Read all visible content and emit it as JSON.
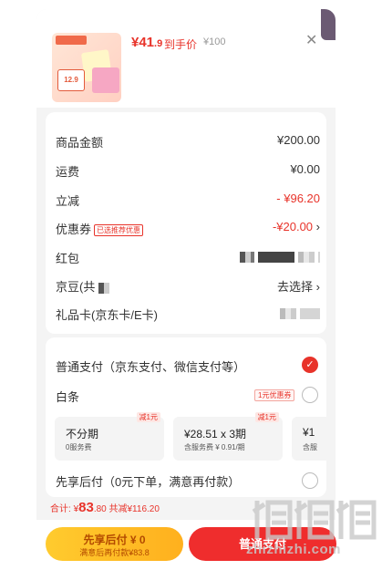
{
  "product": {
    "hand_price_main": "¥41",
    "hand_price_cents": ".9",
    "hand_price_label": "到手价",
    "original_price": "¥100",
    "thumbnail_sticker": "12.9"
  },
  "details": {
    "rows": [
      {
        "label": "商品金额",
        "value": "¥200.00"
      },
      {
        "label": "运费",
        "value": "¥0.00"
      },
      {
        "label": "立减",
        "value": "- ¥96.20"
      },
      {
        "label": "优惠券",
        "badge": "已选推荐优惠",
        "value": "-¥20.00",
        "chevron": "›"
      },
      {
        "label": "红包"
      },
      {
        "label": "京豆(共",
        "value": "去选择",
        "chevron": "›"
      },
      {
        "label": "礼品卡(京东卡/E卡)"
      }
    ]
  },
  "payment": {
    "normal_pay_label": "普通支付（京东支付、微信支付等）",
    "baitiao_label": "白条",
    "baitiao_coupon": "1元优惠券",
    "plans": [
      {
        "title": "不分期",
        "sub": "0服务费",
        "flag": "减1元"
      },
      {
        "title": "¥28.51 x 3期",
        "sub": "含服务费 ¥ 0.91/期",
        "flag": "减1元"
      },
      {
        "title": "¥1",
        "sub": "含服",
        "flag": ""
      }
    ],
    "pay_later_label": "先享后付（0元下单，满意再付款）"
  },
  "footer": {
    "total_prefix": "合计: ",
    "total_currency": "¥",
    "total_int": "83",
    "total_dec": ".80",
    "total_discount": " 共减¥116.20",
    "pay_later_btn_title": "先享后付 ¥ 0",
    "pay_later_btn_sub": "满意后再付款¥83.8",
    "normal_pay_btn": "普通支付"
  },
  "watermark": {
    "text": "zhizhizhi.com"
  },
  "colors": {
    "accent": "#e8332a",
    "pay_later": "#ffb01e",
    "pay_normal": "#ef2d2d"
  }
}
